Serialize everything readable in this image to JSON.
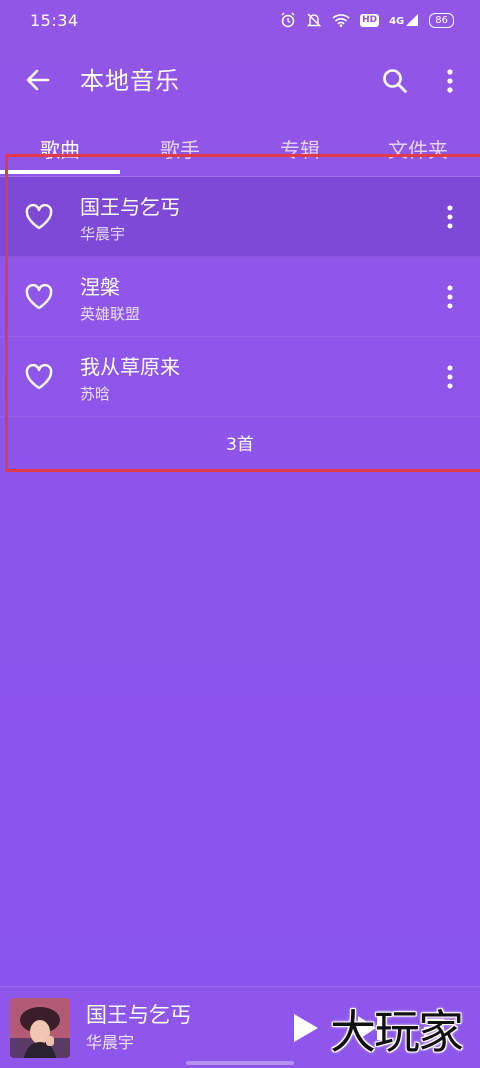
{
  "status_bar": {
    "time": "15:34",
    "hd_label": "HD",
    "network_label": "4G",
    "battery": "86",
    "icons": [
      "alarm-icon",
      "mute-icon",
      "wifi-icon",
      "hd-icon",
      "signal-icon",
      "battery-icon"
    ]
  },
  "app_bar": {
    "title": "本地音乐",
    "back_icon": "back-arrow-icon",
    "search_icon": "search-icon",
    "more_icon": "more-vertical-icon"
  },
  "tabs": [
    {
      "label": "歌曲",
      "active": true
    },
    {
      "label": "歌手",
      "active": false
    },
    {
      "label": "专辑",
      "active": false
    },
    {
      "label": "文件夹",
      "active": false
    }
  ],
  "songs": [
    {
      "title": "国王与乞丐",
      "artist": "华晨宇",
      "selected": true
    },
    {
      "title": "涅槃",
      "artist": "英雄联盟",
      "selected": false
    },
    {
      "title": "我从草原来",
      "artist": "苏晗",
      "selected": false
    }
  ],
  "song_count": "3首",
  "now_playing": {
    "title": "国王与乞丐",
    "artist": "华晨宇",
    "icons": [
      "play-icon",
      "skip-next-icon",
      "queue-icon"
    ]
  },
  "watermark": "大玩家",
  "colors": {
    "background": "#8c55ec",
    "selected_row": "#7e49d6",
    "highlight_box": "#e03a4a",
    "text": "#ffffff"
  }
}
